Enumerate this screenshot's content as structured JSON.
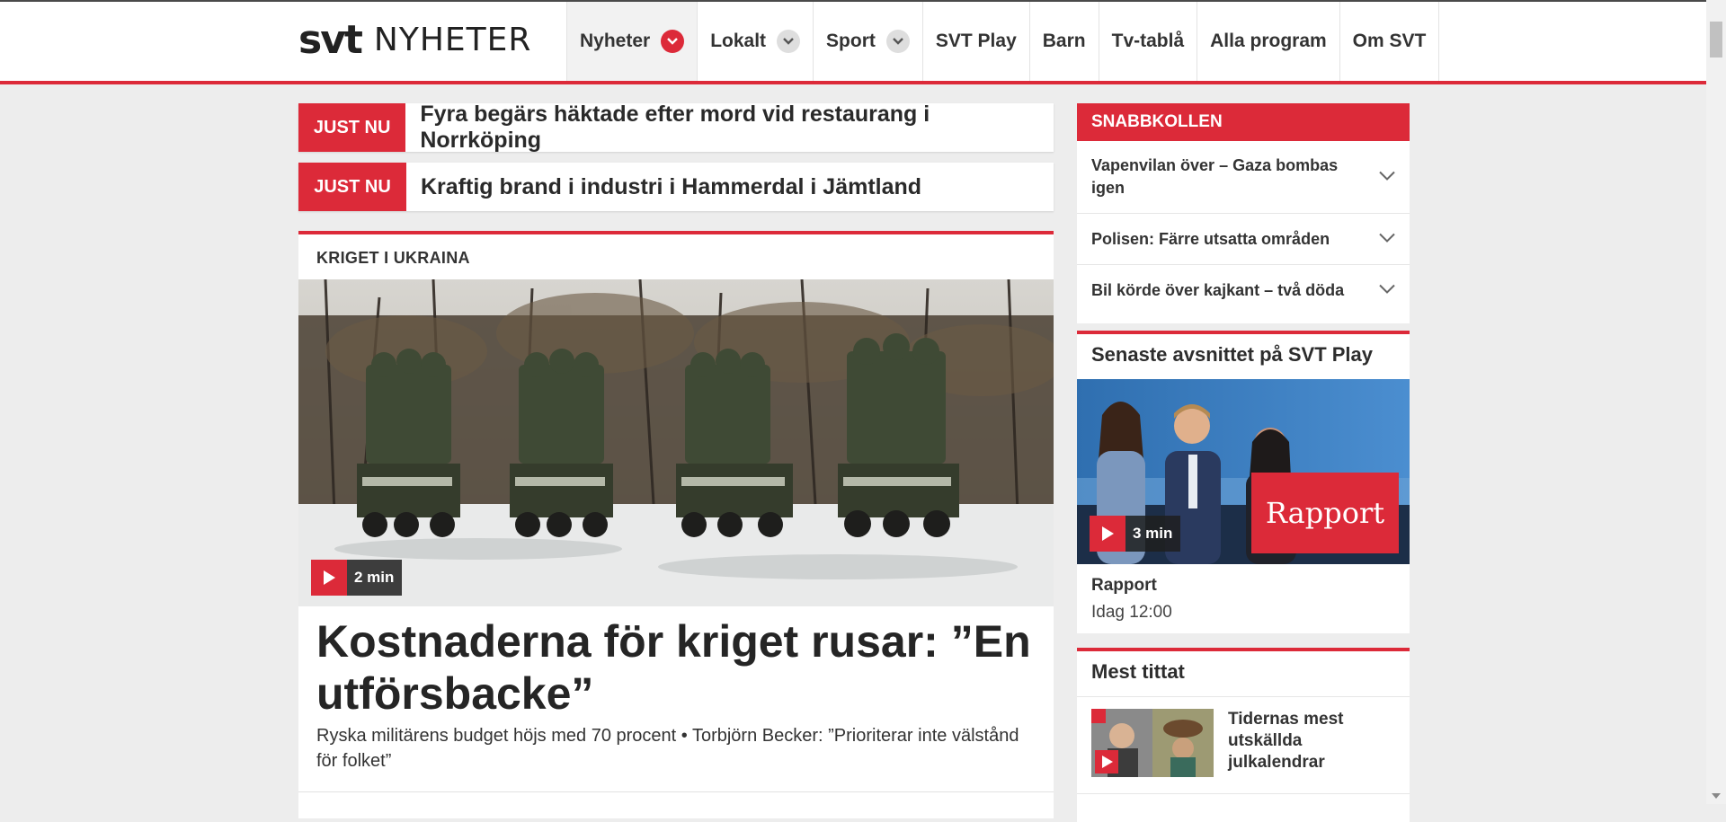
{
  "header": {
    "logo_svt": "svt",
    "logo_section": "NYHETER",
    "nav": [
      {
        "label": "Nyheter",
        "has_menu": true
      },
      {
        "label": "Lokalt",
        "has_menu": true
      },
      {
        "label": "Sport",
        "has_menu": true
      },
      {
        "label": "SVT Play",
        "has_menu": false
      },
      {
        "label": "Barn",
        "has_menu": false
      },
      {
        "label": "Tv-tablå",
        "has_menu": false
      },
      {
        "label": "Alla program",
        "has_menu": false
      },
      {
        "label": "Om SVT",
        "has_menu": false
      }
    ]
  },
  "breaking": [
    {
      "badge": "JUST NU",
      "text": "Fyra begärs häktade efter mord vid restaurang i Norrköping"
    },
    {
      "badge": "JUST NU",
      "text": "Kraftig brand i industri i Hammerdal i Jämtland"
    }
  ],
  "main_article": {
    "kicker": "KRIGET I UKRAINA",
    "video_duration": "2 min",
    "title": "Kostnaderna för kriget rusar: ”En utförsbacke”",
    "subtitle": "Ryska militärens budget höjs med 70 procent • Torbjörn Becker: ”Prioriterar inte välstånd för folket”"
  },
  "snabbkollen": {
    "heading": "SNABBKOLLEN",
    "items": [
      "Vapenvilan över – Gaza bombas igen",
      "Polisen: Färre utsatta områden",
      "Bil körde över kajkant – två döda"
    ]
  },
  "svt_play": {
    "heading": "Senaste avsnittet på SVT Play",
    "duration": "3 min",
    "overlay_label": "Rapport",
    "show": "Rapport",
    "time": "Idag 12:00"
  },
  "mest_tittat": {
    "heading": "Mest tittat",
    "items": [
      {
        "title": "Tidernas mest utskällda julkalendrar"
      }
    ]
  },
  "colors": {
    "accent": "#dc2a39",
    "background": "#ededed",
    "text": "#222222"
  },
  "icons": {
    "nav_chevron": "chevron-down-icon",
    "snabbkollen_item": "expand-icon",
    "video_badge": "play-icon"
  }
}
